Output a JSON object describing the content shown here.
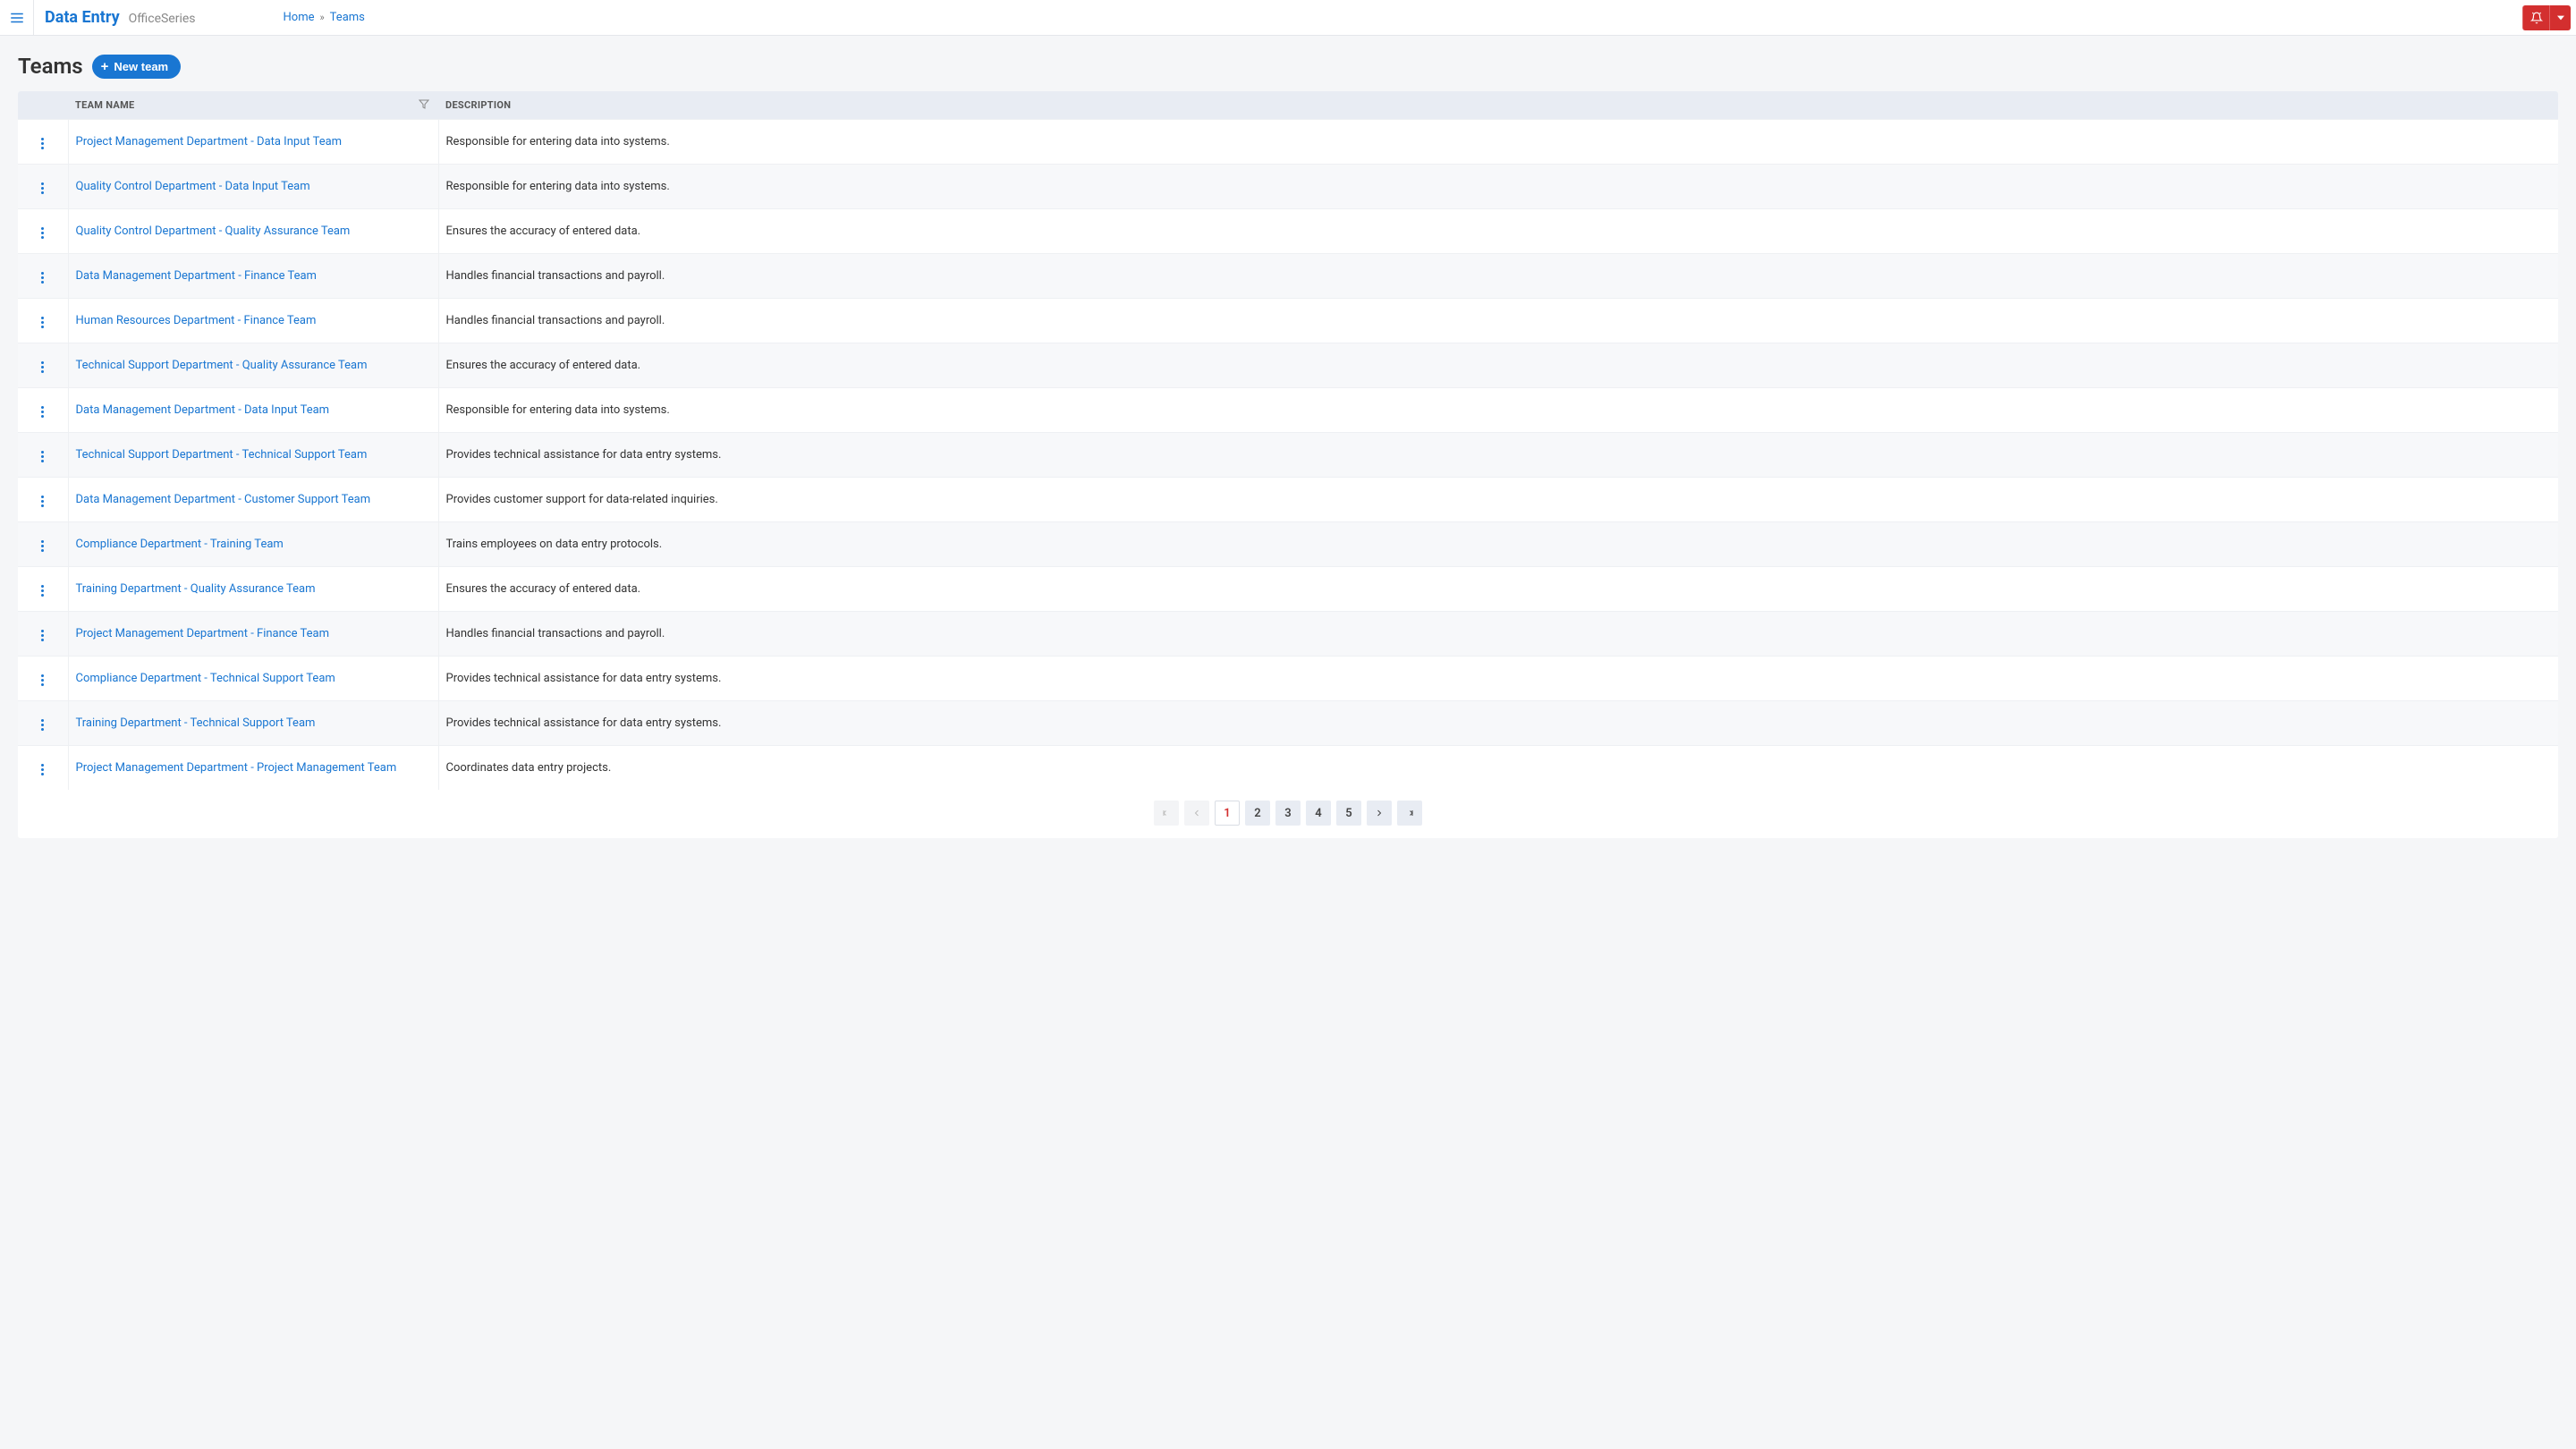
{
  "header": {
    "brand_main": "Data Entry",
    "brand_sub": "OfficeSeries",
    "breadcrumb": {
      "home": "Home",
      "current": "Teams"
    }
  },
  "page": {
    "title": "Teams",
    "new_button": "New team"
  },
  "table": {
    "columns": {
      "name": "TEAM NAME",
      "description": "DESCRIPTION"
    },
    "rows": [
      {
        "name": "Project Management Department - Data Input Team",
        "description": "Responsible for entering data into systems."
      },
      {
        "name": "Quality Control Department - Data Input Team",
        "description": "Responsible for entering data into systems."
      },
      {
        "name": "Quality Control Department - Quality Assurance Team",
        "description": "Ensures the accuracy of entered data."
      },
      {
        "name": "Data Management Department - Finance Team",
        "description": "Handles financial transactions and payroll."
      },
      {
        "name": "Human Resources Department - Finance Team",
        "description": "Handles financial transactions and payroll."
      },
      {
        "name": "Technical Support Department - Quality Assurance Team",
        "description": "Ensures the accuracy of entered data."
      },
      {
        "name": "Data Management Department - Data Input Team",
        "description": "Responsible for entering data into systems."
      },
      {
        "name": "Technical Support Department - Technical Support Team",
        "description": "Provides technical assistance for data entry systems."
      },
      {
        "name": "Data Management Department - Customer Support Team",
        "description": "Provides customer support for data-related inquiries."
      },
      {
        "name": "Compliance Department - Training Team",
        "description": "Trains employees on data entry protocols."
      },
      {
        "name": "Training Department - Quality Assurance Team",
        "description": "Ensures the accuracy of entered data."
      },
      {
        "name": "Project Management Department - Finance Team",
        "description": "Handles financial transactions and payroll."
      },
      {
        "name": "Compliance Department - Technical Support Team",
        "description": "Provides technical assistance for data entry systems."
      },
      {
        "name": "Training Department - Technical Support Team",
        "description": "Provides technical assistance for data entry systems."
      },
      {
        "name": "Project Management Department - Project Management Team",
        "description": "Coordinates data entry projects."
      }
    ]
  },
  "pagination": {
    "pages": [
      "1",
      "2",
      "3",
      "4",
      "5"
    ],
    "current": "1"
  }
}
